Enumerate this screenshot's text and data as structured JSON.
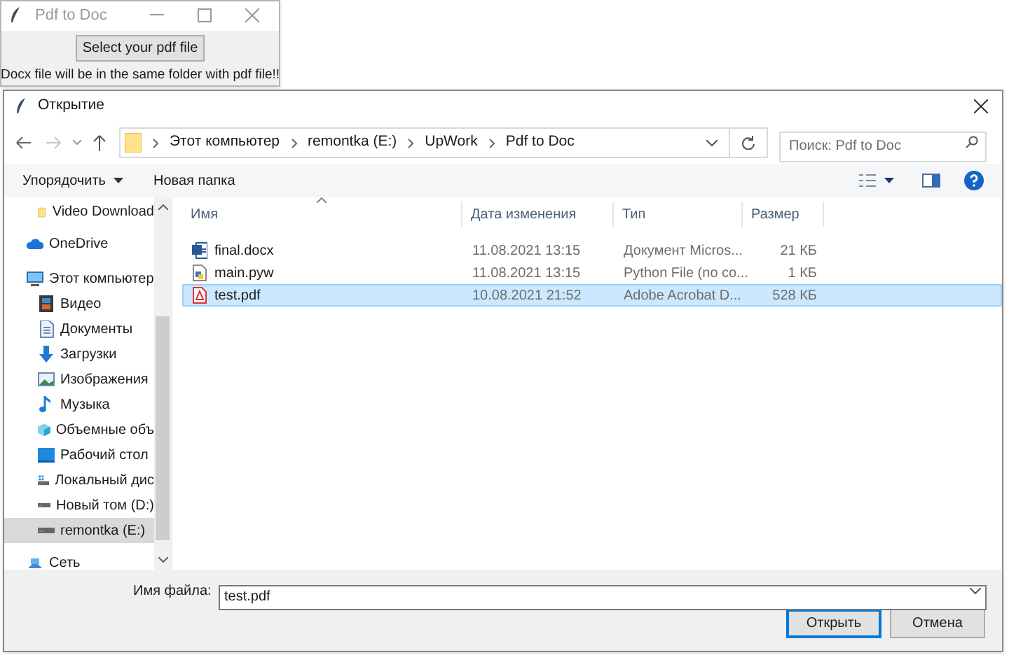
{
  "app_window": {
    "title": "Pdf to Doc",
    "button": "Select your pdf file",
    "message": "Docx file will be in the same folder with pdf file!!"
  },
  "dialog": {
    "title": "Открытие",
    "breadcrumb": [
      "Этот компьютер",
      "remontka (E:)",
      "UpWork",
      "Pdf to Doc"
    ],
    "search": {
      "placeholder": "Поиск: Pdf to Doc"
    },
    "toolbar": {
      "organize": "Упорядочить",
      "new_folder": "Новая папка"
    },
    "sidebar": {
      "quick_access_items": [
        {
          "label": "Video Download",
          "kind": "folder",
          "selected": false
        }
      ],
      "items": [
        {
          "label": "OneDrive",
          "kind": "cloud",
          "selected": false
        },
        {
          "label": "Этот компьютер",
          "kind": "computer",
          "selected": false,
          "children": [
            {
              "label": "Видео",
              "kind": "video",
              "selected": false
            },
            {
              "label": "Документы",
              "kind": "documents",
              "selected": false
            },
            {
              "label": "Загрузки",
              "kind": "downloads",
              "selected": false
            },
            {
              "label": "Изображения",
              "kind": "pictures",
              "selected": false
            },
            {
              "label": "Музыка",
              "kind": "music",
              "selected": false
            },
            {
              "label": "Объемные объ",
              "kind": "objects",
              "selected": false
            },
            {
              "label": "Рабочий стол",
              "kind": "desktop",
              "selected": false
            },
            {
              "label": "Локальный дис",
              "kind": "drive_os",
              "selected": false
            },
            {
              "label": "Новый том (D:)",
              "kind": "drive",
              "selected": false
            },
            {
              "label": "remontka (E:)",
              "kind": "drive",
              "selected": true
            }
          ]
        },
        {
          "label": "Сеть",
          "kind": "network",
          "selected": false
        }
      ]
    },
    "table": {
      "columns": [
        "Имя",
        "Дата изменения",
        "Тип",
        "Размер"
      ],
      "rows": [
        {
          "name": "final.docx",
          "kind": "docx",
          "date": "11.08.2021 13:15",
          "type": "Документ Micros...",
          "size": "21 КБ",
          "selected": false
        },
        {
          "name": "main.pyw",
          "kind": "python",
          "date": "11.08.2021 13:15",
          "type": "Python File (no co...",
          "size": "1 КБ",
          "selected": false
        },
        {
          "name": "test.pdf",
          "kind": "pdf",
          "date": "10.08.2021 21:52",
          "type": "Adobe Acrobat D...",
          "size": "528 КБ",
          "selected": true
        }
      ]
    },
    "filename": {
      "label": "Имя файла:",
      "value": "test.pdf"
    },
    "buttons": [
      {
        "label": "Открыть",
        "default": true
      },
      {
        "label": "Отмена",
        "default": false
      }
    ]
  }
}
